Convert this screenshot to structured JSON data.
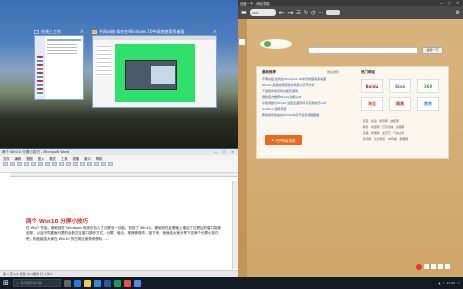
{
  "task_view": {
    "win1_title": "在线上工作",
    "win2_title": "不再纠结 如何在Windows 10中高效使用多桌面"
  },
  "word": {
    "title": "两个 Win10 分屏小技巧 - Microsoft Word",
    "menu": [
      "文件",
      "编辑",
      "视图",
      "插入",
      "格式",
      "工具",
      "表格",
      "窗口",
      "帮助"
    ],
    "heading": "两个 Win10 分屏小技巧",
    "body": "在 Win7 开始，微软就在 Windows 系统中加入了分屏这一功能。但到了 Win10，微软则在此基础上增加了分屏后的窗口智能选择，以及不同桌面分屏的全新交互窗口操作方式，分屏、组合、拖拽等操作。接下来，我就给大家分享下这两个分屏小技巧吧，相信能给大家在 Win10 的日常应用带来便利……",
    "status": "第 1 页  1/1  位置 12.5厘米  行 1  列 1"
  },
  "browser": {
    "title": "百度一下 - 网址导航",
    "url_text": "html",
    "search_button": "搜索一下",
    "left_title": "最新推荐",
    "left_more": "更多推荐",
    "right_title": "热门网站",
    "lines": [
      "不再纠结 如何在Windows 10中高效使用多桌面",
      "Win10 系统如何修改文件默认打开方式",
      "下载软件的同时也能玩游戏",
      "微软官方推荐Win10功能.pdf",
      "平板电脑与Win10 适配全面测评与实用技巧.pdf",
      "Surface 使用手册",
      "教你如何快速在Win10中打开任务视图面板"
    ],
    "sites": [
      "Baidu",
      "Sina",
      "360",
      "淘宝",
      "网易",
      "京东"
    ],
    "open_button": "打开网址导航",
    "links": [
      [
        "· 百度",
        "· 新浪",
        "· 腾讯网",
        "· 搜狐网"
      ],
      [
        "· 网易",
        "· 淘宝网",
        "· 京东商城",
        "· 凤凰网"
      ],
      [
        "· 天猫",
        "· 优酷网",
        "· 爱奇艺",
        "· 汽车之家"
      ],
      [
        "· 新华网",
        "· 东方财富",
        "· 58同城",
        "· 携程网"
      ]
    ]
  },
  "taskbar": {
    "search_placeholder": "有问题尽管问我",
    "time": "12:00"
  },
  "colors": {
    "word_accent": "#2b579a",
    "heading": "#e02424",
    "browser_bg": "#d8b27c"
  }
}
